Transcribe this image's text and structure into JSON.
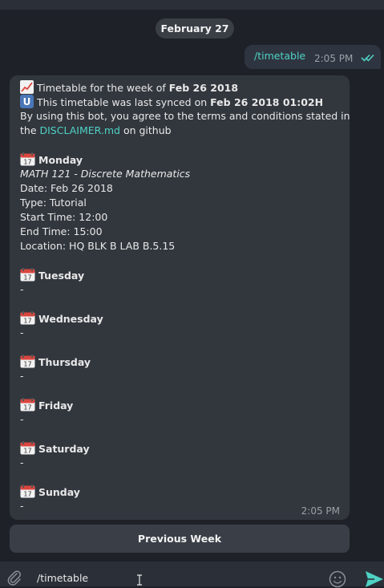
{
  "header": {
    "cut_text": "•••"
  },
  "date_divider": "February 27",
  "outgoing": {
    "text": "/timetable",
    "time": "2:05 PM"
  },
  "incoming": {
    "lines": [
      {
        "type": "head",
        "icon": "chart-increasing",
        "pre": "Timetable for the week of ",
        "bold": "Feb 26 2018"
      },
      {
        "type": "head",
        "icon": "u-symbol",
        "pre": "This timetable was last synced on ",
        "bold": "Feb 26 2018 01:02H"
      },
      {
        "type": "plain",
        "text": "By using this bot, you agree to the terms and conditions stated in"
      },
      {
        "type": "link",
        "pre": "the ",
        "link": "DISCLAIMER.md",
        "post": " on github"
      },
      {
        "type": "gap"
      },
      {
        "type": "day",
        "text": "Monday"
      },
      {
        "type": "italic",
        "text": "MATH 121 - Discrete Mathematics"
      },
      {
        "type": "plain",
        "text": "Date: Feb 26 2018"
      },
      {
        "type": "plain",
        "text": "Type: Tutorial"
      },
      {
        "type": "plain",
        "text": "Start Time: 12:00"
      },
      {
        "type": "plain",
        "text": "End Time: 15:00"
      },
      {
        "type": "plain",
        "text": "Location: HQ BLK B LAB B.5.15"
      },
      {
        "type": "gap"
      },
      {
        "type": "day",
        "text": "Tuesday"
      },
      {
        "type": "plain",
        "text": "-"
      },
      {
        "type": "gap"
      },
      {
        "type": "day",
        "text": "Wednesday"
      },
      {
        "type": "plain",
        "text": "-"
      },
      {
        "type": "gap"
      },
      {
        "type": "day",
        "text": "Thursday"
      },
      {
        "type": "plain",
        "text": "-"
      },
      {
        "type": "gap"
      },
      {
        "type": "day",
        "text": "Friday"
      },
      {
        "type": "plain",
        "text": "-"
      },
      {
        "type": "gap"
      },
      {
        "type": "day",
        "text": "Saturday"
      },
      {
        "type": "plain",
        "text": "-"
      },
      {
        "type": "gap"
      },
      {
        "type": "day",
        "text": "Sunday"
      },
      {
        "type": "plain",
        "text": "-"
      }
    ],
    "time": "2:05 PM"
  },
  "keyboard_button": "Previous Week",
  "composer": {
    "value": "/timetable"
  },
  "colors": {
    "accent": "#4ed1c4",
    "background": "#1e2228",
    "bubble": "#32373e"
  }
}
